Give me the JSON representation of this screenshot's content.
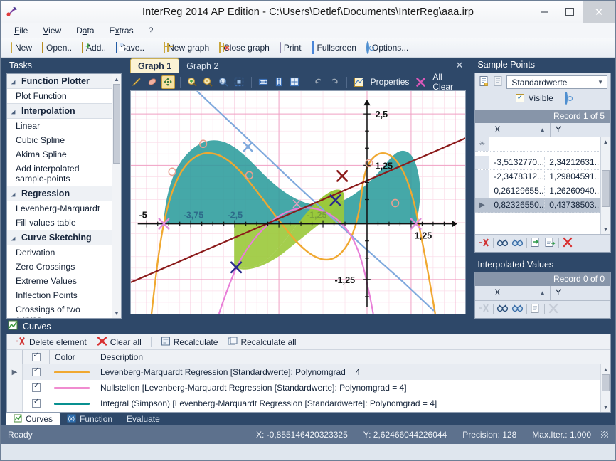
{
  "window": {
    "title": "InterReg 2014 AP Edition - C:\\Users\\Detlef\\Documents\\InterReg\\aaa.irp",
    "minimize": "−",
    "maximize": "□",
    "close": "✕",
    "logo_icon": "interreg-logo"
  },
  "menubar": [
    {
      "label": "File"
    },
    {
      "label": "View"
    },
    {
      "label": "Data"
    },
    {
      "label": "Extras"
    },
    {
      "label": "?"
    }
  ],
  "toolbar": [
    {
      "label": "New",
      "icon": "new-document-icon"
    },
    {
      "label": "Open..",
      "icon": "open-folder-icon"
    },
    {
      "label": "Add..",
      "icon": "add-folder-icon"
    },
    {
      "label": "Save..",
      "icon": "floppy-disk-icon"
    },
    {
      "sep": true
    },
    {
      "label": "New graph",
      "icon": "new-graph-icon"
    },
    {
      "label": "Close graph",
      "icon": "close-graph-icon"
    },
    {
      "label": "Print",
      "icon": "printer-icon"
    },
    {
      "label": "Fullscreen",
      "icon": "fullscreen-icon"
    },
    {
      "label": "Options...",
      "icon": "gear-icon"
    }
  ],
  "sidebar": {
    "title": "Tasks",
    "items": [
      {
        "label": "Function Plotter",
        "type": "group"
      },
      {
        "label": "Plot Function",
        "type": "task"
      },
      {
        "label": "Interpolation",
        "type": "group"
      },
      {
        "label": "Linear",
        "type": "task"
      },
      {
        "label": "Cubic Spline",
        "type": "task"
      },
      {
        "label": "Akima Spline",
        "type": "task"
      },
      {
        "label": "Add interpolated sample-points",
        "type": "task"
      },
      {
        "label": "Regression",
        "type": "group"
      },
      {
        "label": "Levenberg-Marquardt",
        "type": "task"
      },
      {
        "label": "Fill values table",
        "type": "task"
      },
      {
        "label": "Curve Sketching",
        "type": "group"
      },
      {
        "label": "Derivation",
        "type": "task"
      },
      {
        "label": "Zero Crossings",
        "type": "task"
      },
      {
        "label": "Extreme Values",
        "type": "task"
      },
      {
        "label": "Inflection Points",
        "type": "task"
      },
      {
        "label": "Crossings of two curves",
        "type": "task"
      }
    ]
  },
  "graph": {
    "tabs": [
      {
        "label": "Graph 1",
        "active": true
      },
      {
        "label": "Graph 2",
        "active": false
      }
    ],
    "close_label": "✕",
    "tools": [
      {
        "icon": "pencil-icon",
        "selected": false
      },
      {
        "icon": "eraser-icon",
        "selected": false
      },
      {
        "icon": "move-icon",
        "selected": true
      },
      {
        "sep": true
      },
      {
        "icon": "zoom-in-icon",
        "selected": false
      },
      {
        "icon": "zoom-out-icon",
        "selected": false
      },
      {
        "icon": "zoom-actual-icon",
        "selected": false
      },
      {
        "icon": "zoom-fit-icon",
        "selected": false
      },
      {
        "sep": true
      },
      {
        "icon": "fit-horizontal-icon",
        "selected": false
      },
      {
        "icon": "fit-vertical-icon",
        "selected": false
      },
      {
        "icon": "fit-both-icon",
        "selected": false
      },
      {
        "sep": true
      },
      {
        "icon": "undo-icon",
        "selected": false
      },
      {
        "icon": "redo-icon",
        "selected": false
      },
      {
        "sep": true
      }
    ],
    "properties_label": "Properties",
    "properties_icon": "properties-icon",
    "allclear_label": "All Clear",
    "allclear_icon": "clear-x-icon"
  },
  "chart_data": {
    "type": "line",
    "title": "",
    "xlabel": "",
    "ylabel": "",
    "xlim": [
      -5.6,
      1.9
    ],
    "ylim": [
      -2.2,
      3.1
    ],
    "x_ticks": [
      -5,
      -3.75,
      -2.5,
      -1.25,
      1.25
    ],
    "x_tick_labels": [
      "-5",
      "-3,75",
      "-2,5",
      "-1,25",
      "1,25"
    ],
    "y_ticks": [
      2.5,
      1.25,
      -1.25
    ],
    "y_tick_labels": [
      "2,5",
      "1,25",
      "-1,25"
    ],
    "grid": true,
    "grid_color": "#f0a8c8",
    "legend": "none",
    "series": [
      {
        "name": "Levenberg-Marquardt Regression [Standardwerte]: Polynomgrad = 4",
        "color": "#f0a830",
        "type": "line",
        "points": [
          [
            -5.0,
            -2.2
          ],
          [
            -4.6,
            -0.5
          ],
          [
            -4.3,
            0.6
          ],
          [
            -4.0,
            1.35
          ],
          [
            -3.75,
            1.8
          ],
          [
            -3.5,
            2.12
          ],
          [
            -3.3,
            2.3
          ],
          [
            -3.1,
            2.3
          ],
          [
            -2.9,
            2.1
          ],
          [
            -2.6,
            1.55
          ],
          [
            -2.3,
            0.75
          ],
          [
            -2.0,
            -0.15
          ],
          [
            -1.75,
            -0.9
          ],
          [
            -1.5,
            -1.4
          ],
          [
            -1.3,
            -1.55
          ],
          [
            -1.1,
            -1.35
          ],
          [
            -0.9,
            -0.85
          ],
          [
            -0.7,
            -0.2
          ],
          [
            -0.45,
            0.45
          ],
          [
            -0.2,
            0.85
          ],
          [
            0.0,
            0.95
          ],
          [
            0.25,
            0.82
          ],
          [
            0.5,
            0.5
          ],
          [
            0.8,
            -0.15
          ],
          [
            1.1,
            -1.1
          ],
          [
            1.4,
            -2.2
          ]
        ]
      },
      {
        "name": "Integral (Simpson) [Levenberg-Marquardt Regression [Standardwerte]: Polynomgrad = 4]",
        "color": "#089090",
        "fill": "#1e9b9b",
        "type": "area"
      },
      {
        "name": "Nullstellen [Levenberg-Marquardt Regression [Standardwerte]: Polynomgrad = 4]",
        "color": "#f08cd0",
        "type": "line"
      },
      {
        "name": "derivative-curve",
        "color": "#7fa9dd",
        "type": "line"
      },
      {
        "name": "secant-line",
        "color": "#8b1a1a",
        "type": "line"
      },
      {
        "name": "green-area",
        "color": "#9ac93a",
        "type": "area"
      }
    ],
    "markers": {
      "sample_points": {
        "shape": "circle",
        "color": "#e8a090"
      },
      "extreme_points": {
        "shape": "x",
        "color": "#2a2a8c"
      },
      "zero_crossings": {
        "shape": "x",
        "color": "#e08ad8"
      },
      "inflection_points": {
        "shape": "x",
        "color": "#8b1a1a"
      }
    }
  },
  "sample_points": {
    "title": "Sample Points",
    "new_icon": "new-dataset-icon",
    "copy_icon": "copy-dataset-icon",
    "dataset": "Standardwerte",
    "visible_label": "Visible",
    "settings_icon": "gear-icon",
    "record_status": "Record 1 of 5",
    "columns": [
      "X",
      "Y"
    ],
    "rows": [
      {
        "x": "",
        "y": "",
        "newrow": true
      },
      {
        "x": "-3,5132770...",
        "y": "2,34212631..."
      },
      {
        "x": "-2,3478312...",
        "y": "1,29804591..."
      },
      {
        "x": "0,26129655...",
        "y": "1,26260940..."
      },
      {
        "x": "0,82326550...",
        "y": "0,43738503...",
        "selected": true
      }
    ],
    "footer_icons": [
      "delete-record-icon",
      "find-icon",
      "find-next-icon",
      "import-icon",
      "export-icon",
      "clear-icon"
    ]
  },
  "interpolated_values": {
    "title": "Interpolated Values",
    "record_status": "Record 0 of 0",
    "columns": [
      "X",
      "Y"
    ],
    "rows": [],
    "footer_icons": [
      "delete-record-icon",
      "find-icon",
      "find-next-icon",
      "export-icon",
      "clear-icon"
    ]
  },
  "curves": {
    "title": "Curves",
    "title_icon": "curves-icon",
    "toolbar": [
      {
        "label": "Delete element",
        "icon": "delete-element-icon"
      },
      {
        "label": "Clear all",
        "icon": "clear-all-icon"
      },
      {
        "sep": true
      },
      {
        "label": "Recalculate",
        "icon": "recalculate-icon"
      },
      {
        "label": "Recalculate all",
        "icon": "recalculate-all-icon"
      }
    ],
    "columns": [
      "Color",
      "Description"
    ],
    "rows": [
      {
        "checked": true,
        "color": "#f0a830",
        "description": "Levenberg-Marquardt Regression [Standardwerte]: Polynomgrad = 4",
        "selected": true
      },
      {
        "checked": true,
        "color": "#f08cd0",
        "description": "Nullstellen [Levenberg-Marquardt Regression [Standardwerte]: Polynomgrad = 4]"
      },
      {
        "checked": true,
        "color": "#089090",
        "description": "Integral (Simpson) [Levenberg-Marquardt Regression [Standardwerte]: Polynomgrad = 4]"
      }
    ],
    "tabs": [
      {
        "label": "Curves",
        "active": true,
        "icon": "curves-icon"
      },
      {
        "label": "Function",
        "active": false,
        "icon": "function-icon"
      },
      {
        "label": "Evaluate",
        "active": false,
        "icon": ""
      }
    ]
  },
  "statusbar": {
    "status": "Ready",
    "x_value": "X: -0,855146420323325",
    "y_value": "Y: 2,62466044226044",
    "precision": "Precision: 128",
    "max_iter": "Max.Iter.: 1.000"
  }
}
